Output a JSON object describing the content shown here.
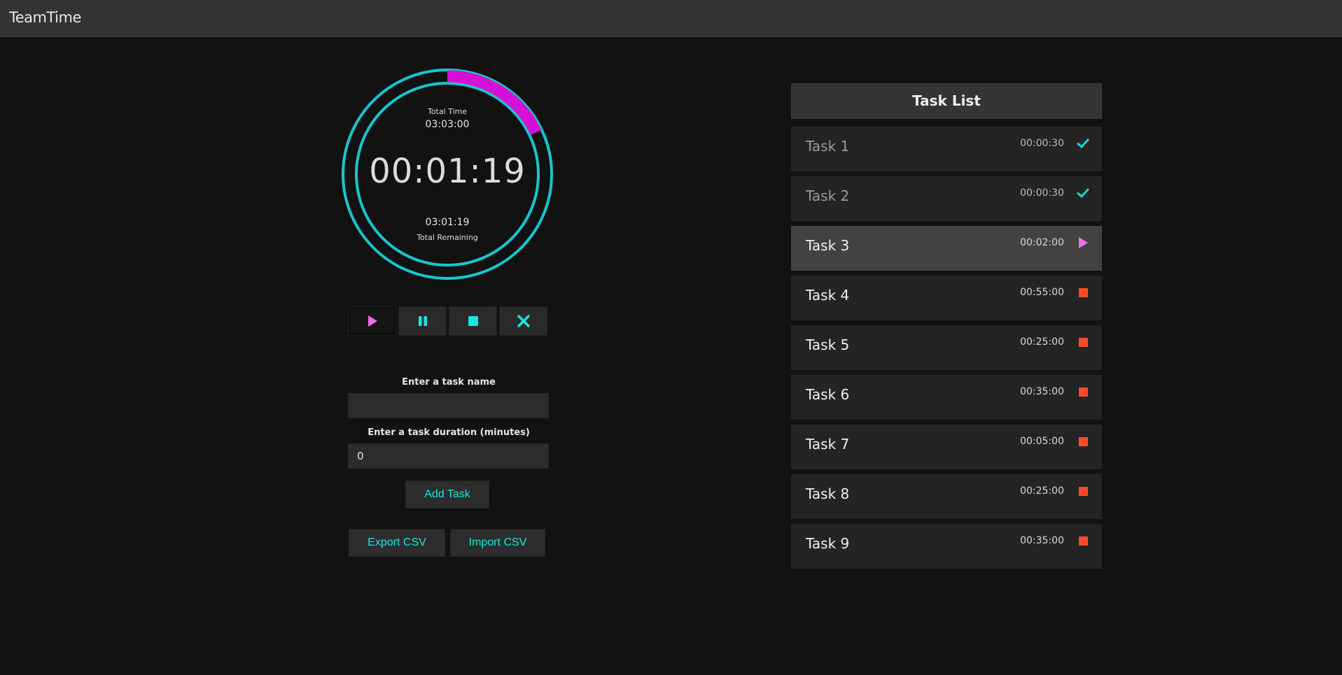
{
  "app": {
    "title": "TeamTime"
  },
  "timer": {
    "total_time_label": "Total Time",
    "total_time": "03:03:00",
    "current": "00:01:19",
    "remaining": "03:01:19",
    "remaining_label": "Total Remaining",
    "progress_fraction": 0.18,
    "colors": {
      "ring": "#17c6cc",
      "progress": "#d610d6"
    }
  },
  "controls": [
    {
      "name": "play-button",
      "icon": "play-icon",
      "active": true
    },
    {
      "name": "pause-button",
      "icon": "pause-icon",
      "active": false
    },
    {
      "name": "stop-button",
      "icon": "stop-icon",
      "active": false
    },
    {
      "name": "clear-button",
      "icon": "close-icon",
      "active": false
    }
  ],
  "form": {
    "task_name_label": "Enter a task name",
    "task_name_value": "",
    "task_duration_label": "Enter a task duration (minutes)",
    "task_duration_value": "0",
    "add_task": "Add Task",
    "export_csv": "Export CSV",
    "import_csv": "Import CSV"
  },
  "task_list": {
    "title": "Task List",
    "tasks": [
      {
        "name": "Task 1",
        "duration": "00:00:30",
        "status": "done"
      },
      {
        "name": "Task 2",
        "duration": "00:00:30",
        "status": "done"
      },
      {
        "name": "Task 3",
        "duration": "00:02:00",
        "status": "running"
      },
      {
        "name": "Task 4",
        "duration": "00:55:00",
        "status": "pending"
      },
      {
        "name": "Task 5",
        "duration": "00:25:00",
        "status": "pending"
      },
      {
        "name": "Task 6",
        "duration": "00:35:00",
        "status": "pending"
      },
      {
        "name": "Task 7",
        "duration": "00:05:00",
        "status": "pending"
      },
      {
        "name": "Task 8",
        "duration": "00:25:00",
        "status": "pending"
      },
      {
        "name": "Task 9",
        "duration": "00:35:00",
        "status": "pending"
      }
    ]
  },
  "colors": {
    "accent": "#19e6e6",
    "play": "#ee6ee8",
    "check": "#19d6d6",
    "pending": "#ff4a2a"
  }
}
